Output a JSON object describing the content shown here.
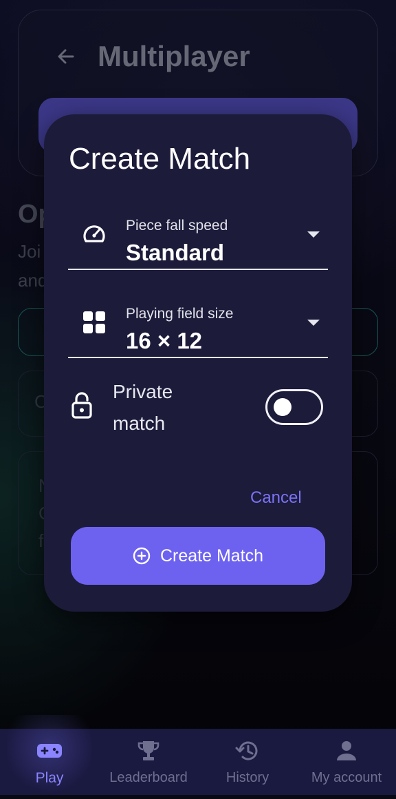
{
  "background_page": {
    "title": "Multiplayer",
    "heading": "Op",
    "subtitle_line1": "Joi",
    "subtitle_line2": "and",
    "card1_text": "C",
    "card2_line1": "N",
    "card2_line2": "C",
    "card2_line3": "f"
  },
  "dialog": {
    "title": "Create Match",
    "fall_speed": {
      "label": "Piece fall speed",
      "value": "Standard"
    },
    "field_size": {
      "label": "Playing field size",
      "value": "16 × 12"
    },
    "private_match": {
      "label": "Private match",
      "enabled": false
    },
    "cancel_label": "Cancel",
    "create_label": "Create Match"
  },
  "nav": {
    "items": [
      {
        "label": "Play",
        "icon": "gamepad-icon",
        "active": true
      },
      {
        "label": "Leaderboard",
        "icon": "trophy-icon",
        "active": false
      },
      {
        "label": "History",
        "icon": "history-icon",
        "active": false
      },
      {
        "label": "My account",
        "icon": "account-icon",
        "active": false
      }
    ]
  },
  "colors": {
    "accent": "#6d62f0",
    "dialog_bg": "#1c1b3a",
    "nav_bg": "#1a1940",
    "active_nav": "#8a84ff",
    "cancel_text": "#7b72f4"
  }
}
